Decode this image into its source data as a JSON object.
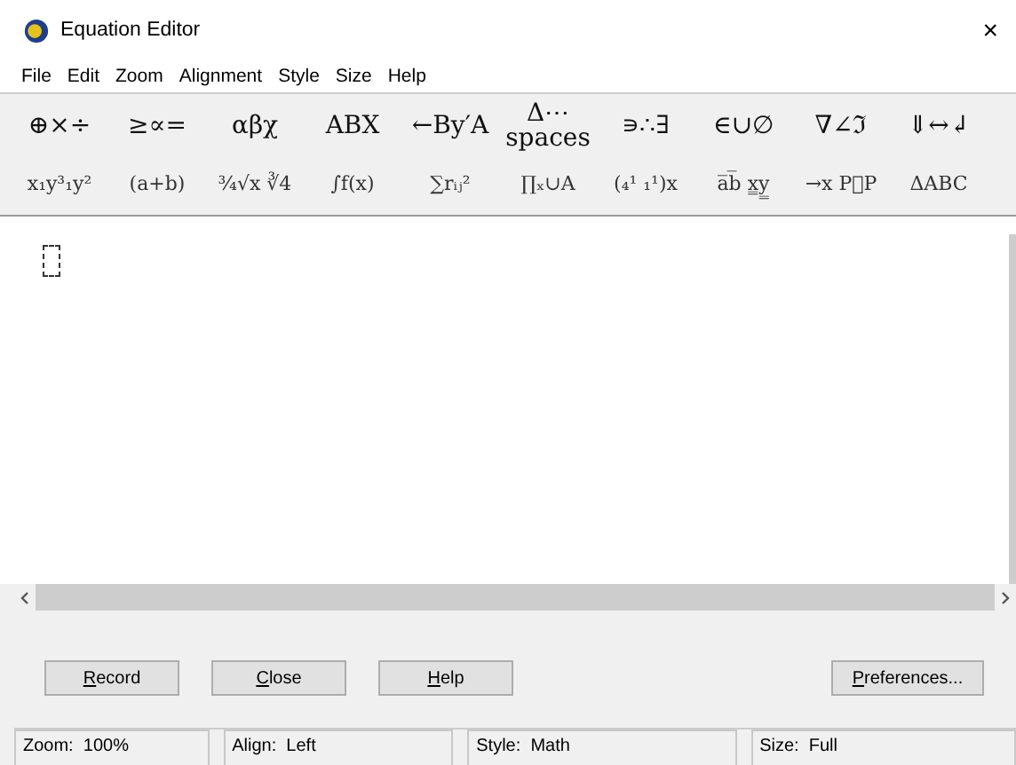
{
  "window": {
    "title": "Equation Editor",
    "close": "×"
  },
  "menu": [
    "File",
    "Edit",
    "Zoom",
    "Alignment",
    "Style",
    "Size",
    "Help"
  ],
  "palettes": [
    [
      "⊕×÷",
      "≥∝=",
      "αβχ",
      "ΑΒΧ",
      "←By′A",
      "Δ⋯\nspaces",
      "∍∴∃",
      "∈∪∅",
      "∇∠ℑ",
      "⇓↔↲"
    ],
    [
      "x₁y³₁y²",
      "(a+b)",
      "¾√x ∛4",
      "∫f(x)",
      "∑rᵢⱼ²",
      "∏ₓ∪A",
      "(₄¹ ₁¹)x",
      "a̅b̅ x̳y̳",
      "→x P⃗P",
      "ΔABC"
    ]
  ],
  "editor": {
    "empty_slot": true
  },
  "buttons": [
    {
      "label": "Record",
      "mnemonic_underlined": true
    },
    {
      "label": "Close",
      "mnemonic_underlined": true
    },
    {
      "label": "Help",
      "mnemonic_underlined": true
    },
    {
      "label": "Preferences...",
      "mnemonic_underlined": true
    }
  ],
  "status_bar": [
    "Zoom:  100%",
    "Align:  Left",
    "Style:  Math",
    "Size:  Full"
  ]
}
